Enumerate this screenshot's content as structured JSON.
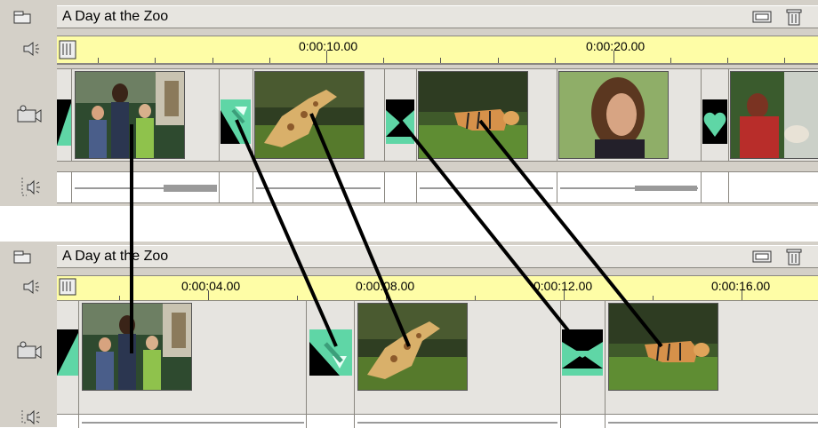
{
  "app": {
    "top_panel": {
      "title": "A Day at the Zoo",
      "ruler": {
        "labels": [
          "0:00:10.00",
          "0:00:20.00"
        ]
      }
    },
    "bottom_panel": {
      "title": "A Day at the Zoo",
      "ruler": {
        "labels": [
          "0:00:04.00",
          "0:00:08.00",
          "0:00:12.00",
          "0:00:16.00"
        ]
      }
    }
  },
  "colors": {
    "panel": "#d4d0c8",
    "ruler": "#fefda6",
    "transition": "#5fd6a6",
    "transition_dark": "#000000"
  },
  "icons": {
    "track_header": "track-header-icon",
    "volume": "speaker-icon",
    "video": "video-camera-icon",
    "audio": "audio-speaker-icon",
    "filmstrip": "filmstrip-icon",
    "trash": "trash-icon"
  },
  "clips": {
    "top": [
      "family-clip",
      "giraffe-clip",
      "tiger-clip",
      "woman-clip",
      "man-clip"
    ],
    "bottom": [
      "family-clip",
      "giraffe-clip",
      "tiger-clip"
    ]
  }
}
